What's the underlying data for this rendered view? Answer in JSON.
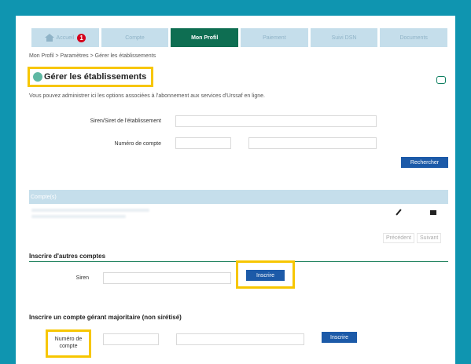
{
  "tabs": [
    {
      "label": "Accueil",
      "badge": "1"
    },
    {
      "label": "Compte"
    },
    {
      "label": "Mon Profil"
    },
    {
      "label": "Paiement"
    },
    {
      "label": "Suivi DSN"
    },
    {
      "label": "Documents"
    }
  ],
  "breadcrumb": "Mon Profil > Paramètres > Gérer les établissements",
  "page_title": "Gérer les établissements",
  "intro": "Vous pouvez administrer ici les options associées à l'abonnement aux services d'Urssaf en ligne.",
  "search": {
    "siren_label": "Siren/Siret de l'établissement",
    "account_label": "Numéro de compte",
    "search_button": "Rechercher"
  },
  "accounts": {
    "header": "Compte(s)",
    "prev": "Précédent",
    "next": "Suivant"
  },
  "other_accounts": {
    "title": "Inscrire d'autres comptes",
    "siren_label": "Siren",
    "button": "Inscrire"
  },
  "manager_account": {
    "title": "Inscrire un compte gérant majoritaire (non sirétisé)",
    "label_line1": "Numéro de",
    "label_line2": "compte",
    "button": "Inscrire"
  },
  "colors": {
    "brand": "#0f95b0",
    "active_tab": "#0e6e52",
    "button": "#1c5aa8",
    "highlight": "#f7c600"
  }
}
